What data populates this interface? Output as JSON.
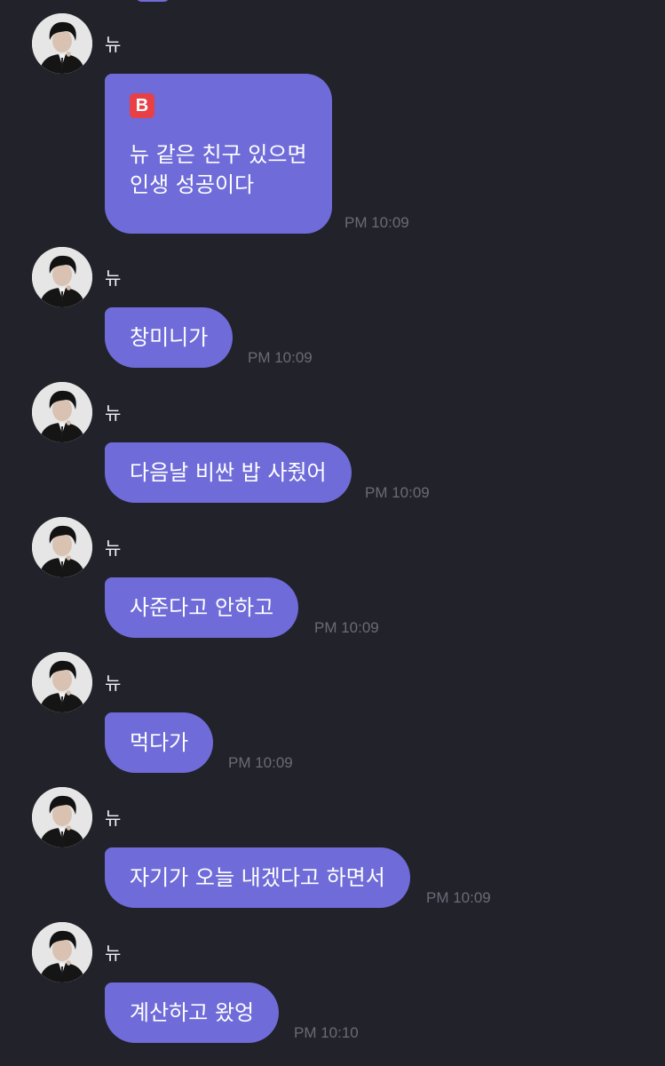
{
  "chat": {
    "messages": [
      {
        "sender": "뉴",
        "text": "뉴 같은 친구 있으면\n인생 성공이다",
        "badge": "B",
        "time": "PM 10:09"
      },
      {
        "sender": "뉴",
        "text": "창미니가",
        "time": "PM 10:09"
      },
      {
        "sender": "뉴",
        "text": "다음날 비싼 밥 사줬어",
        "time": "PM 10:09"
      },
      {
        "sender": "뉴",
        "text": "사준다고 안하고",
        "time": "PM 10:09"
      },
      {
        "sender": "뉴",
        "text": "먹다가",
        "time": "PM 10:09"
      },
      {
        "sender": "뉴",
        "text": "자기가 오늘 내겠다고 하면서",
        "time": "PM 10:09"
      },
      {
        "sender": "뉴",
        "text": "계산하고 왔엉",
        "time": "PM 10:10"
      }
    ]
  },
  "colors": {
    "background": "#22222a",
    "bubble": "#6f6cd9",
    "badge": "#e74047",
    "timestamp": "#6b6b78"
  }
}
